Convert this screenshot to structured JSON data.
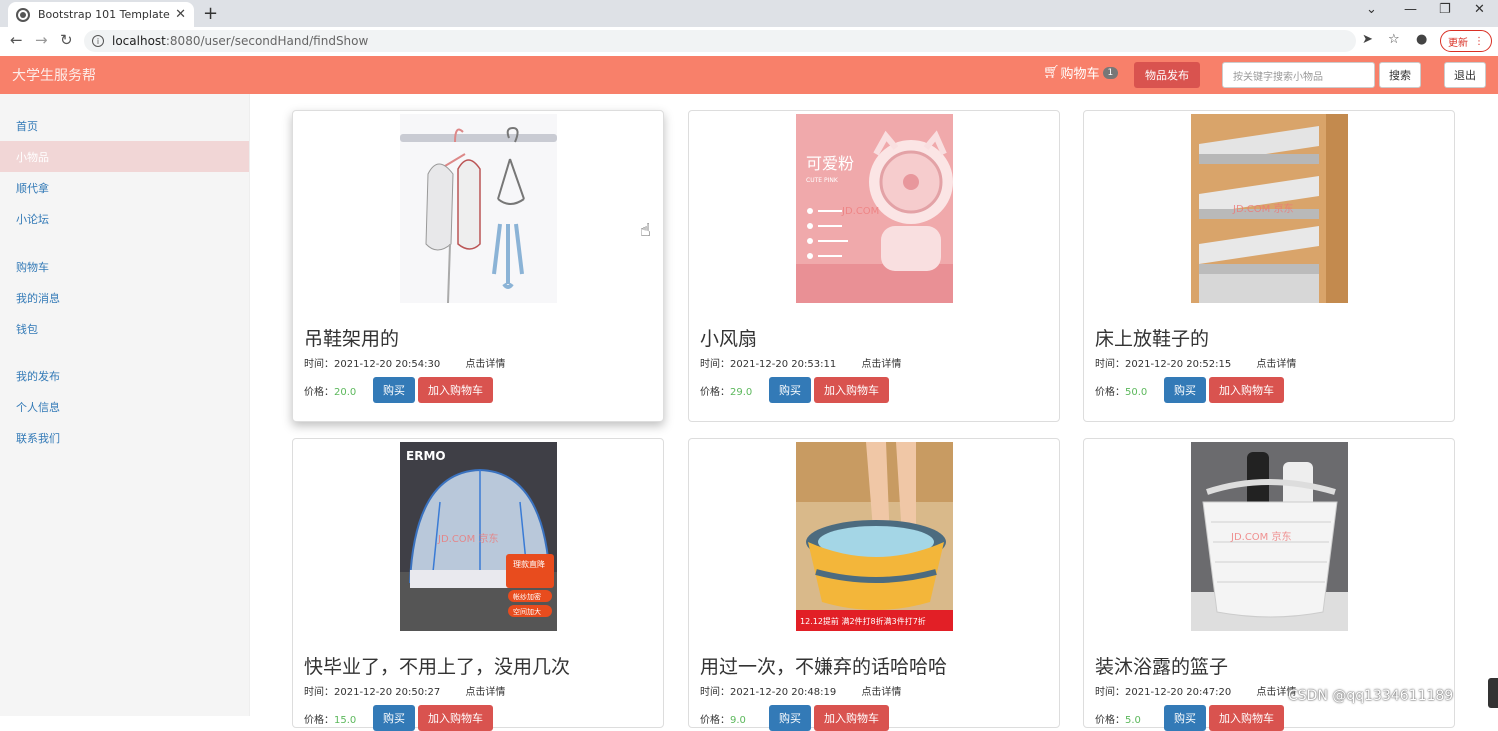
{
  "browser": {
    "tab_title": "Bootstrap 101 Template",
    "tab_close": "✕",
    "new_tab": "+",
    "url_host": "localhost",
    "url_path": ":8080/user/secondHand/findShow",
    "update_label": "更新"
  },
  "navbar": {
    "brand": "大学生服务帮",
    "cart_label": "购物车",
    "cart_count": "1",
    "publish_label": "物品发布",
    "search_placeholder": "按关键字搜索小物品",
    "search_label": "搜索",
    "logout_label": "退出"
  },
  "sidebar": {
    "items": [
      {
        "label": "首页"
      },
      {
        "label": "小物品"
      },
      {
        "label": "顺代拿"
      },
      {
        "label": "小论坛"
      },
      {
        "label": "购物车"
      },
      {
        "label": "我的消息"
      },
      {
        "label": "钱包"
      },
      {
        "label": "我的发布"
      },
      {
        "label": "个人信息"
      },
      {
        "label": "联系我们"
      }
    ]
  },
  "cards": [
    {
      "title": "吊鞋架用的",
      "time": "时间：2021-12-20 20:54:30",
      "detail": "点击详情",
      "price_label": "价格：",
      "price": "20.0",
      "buy": "购买",
      "add_cart": "加入购物车"
    },
    {
      "title": "小风扇",
      "time": "时间：2021-12-20 20:53:11",
      "detail": "点击详情",
      "price_label": "价格：",
      "price": "29.0",
      "buy": "购买",
      "add_cart": "加入购物车",
      "img_text": "可爱粉",
      "img_sub": "CUTE PINK",
      "img_wm": "JD.COM"
    },
    {
      "title": "床上放鞋子的",
      "time": "时间：2021-12-20 20:52:15",
      "detail": "点击详情",
      "price_label": "价格：",
      "price": "50.0",
      "buy": "购买",
      "add_cart": "加入购物车",
      "img_wm": "JD.COM 京东"
    },
    {
      "title": "快毕业了，不用上了，没用几次",
      "time": "时间：2021-12-20 20:50:27",
      "detail": "点击详情",
      "price_label": "价格：",
      "price": "15.0",
      "buy": "购买",
      "add_cart": "加入购物车",
      "img_text": "ERMO",
      "img_wm": "JD.COM 京东",
      "img_tag1": "理款直降",
      "img_tag2": "帐纱加密",
      "img_tag3": "空间加大"
    },
    {
      "title": "用过一次，不嫌弃的话哈哈哈",
      "time": "时间：2021-12-20 20:48:19",
      "detail": "点击详情",
      "price_label": "价格：",
      "price": "9.0",
      "buy": "购买",
      "add_cart": "加入购物车",
      "img_banner": "12.12提前 满2件打8折满3件打7折"
    },
    {
      "title": "装沐浴露的篮子",
      "time": "时间：2021-12-20 20:47:20",
      "detail": "点击详情",
      "price_label": "价格：",
      "price": "5.0",
      "buy": "购买",
      "add_cart": "加入购物车",
      "img_wm": "JD.COM 京东"
    }
  ],
  "watermark": "CSDN @qq1334611189",
  "colors": {
    "navbar": "#f8806a",
    "primary": "#337ab7",
    "danger": "#d9534f",
    "price": "#5cb85c"
  }
}
